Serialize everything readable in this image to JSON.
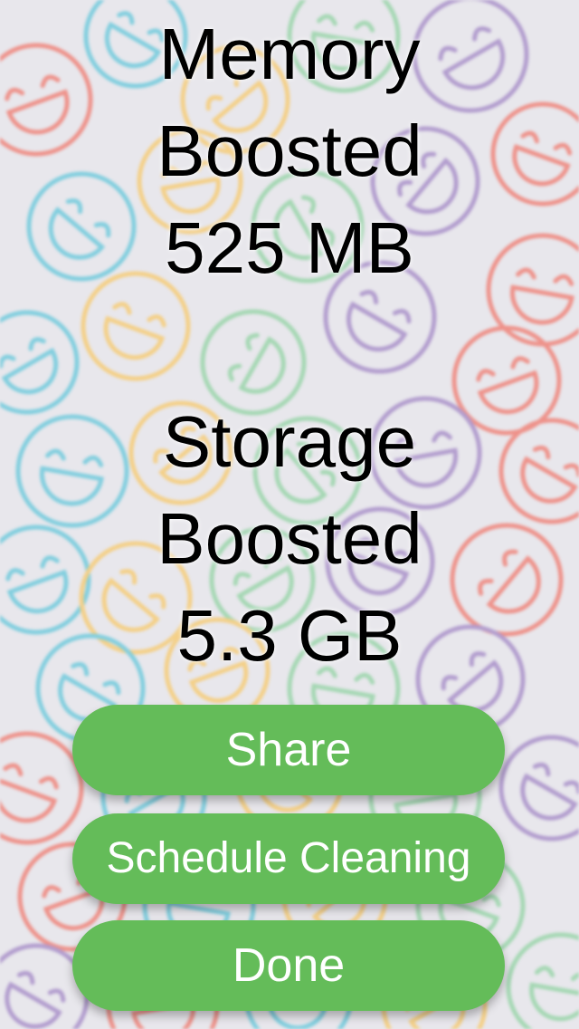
{
  "background": {
    "icon": "laughing-face-icon",
    "colors": [
      "#f0766a",
      "#5fc6da",
      "#f8c866",
      "#8ed2a0",
      "#a084c4"
    ]
  },
  "memory": {
    "line1": "Memory",
    "line2": "Boosted",
    "amount": "525 MB"
  },
  "storage": {
    "line1": "Storage",
    "line2": "Boosted",
    "amount": "5.3 GB"
  },
  "buttons": {
    "share": "Share",
    "schedule": "Schedule Cleaning",
    "done": "Done",
    "color": "#64bc59"
  }
}
